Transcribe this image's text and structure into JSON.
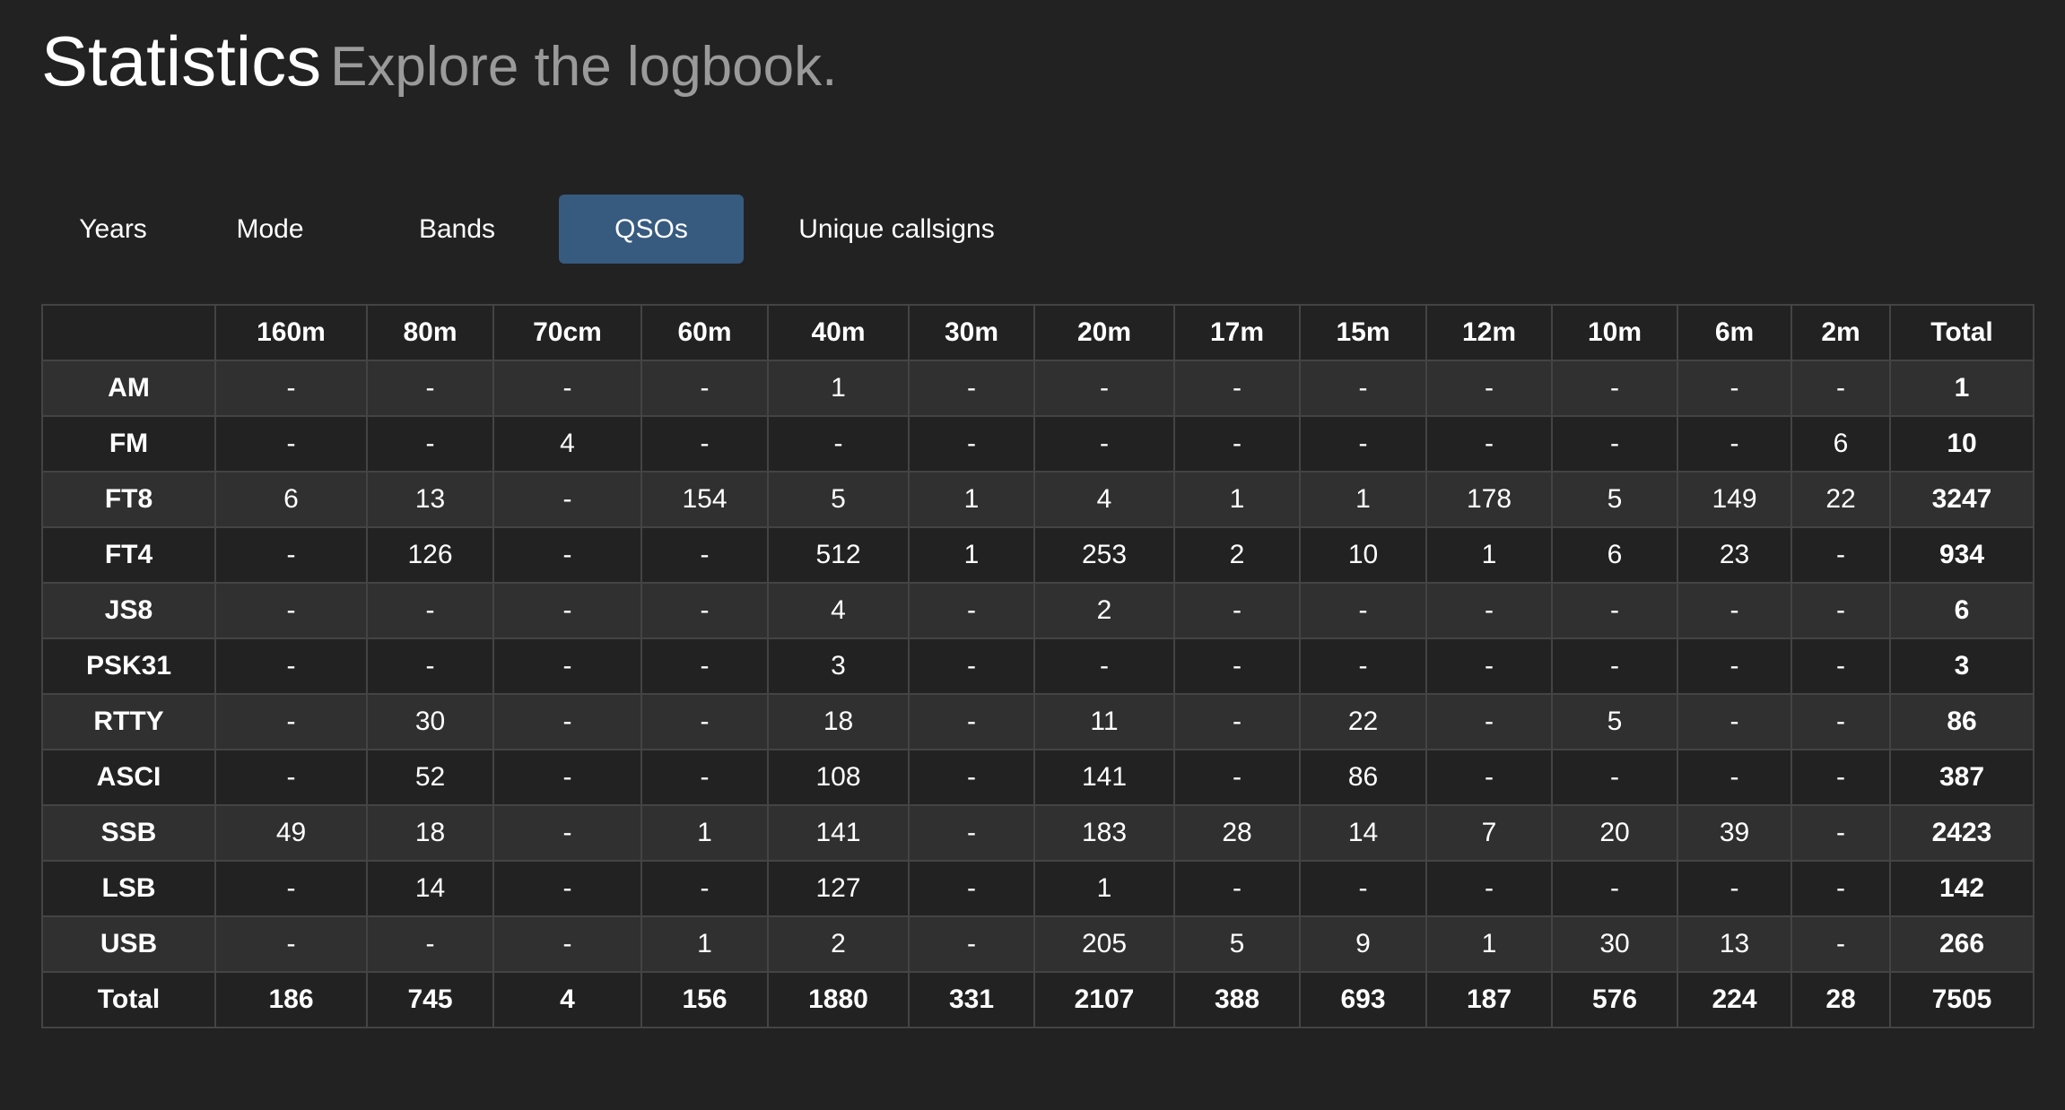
{
  "header": {
    "title": "Statistics",
    "subtitle": "Explore the logbook."
  },
  "tabs": [
    {
      "label": "Years",
      "active": false
    },
    {
      "label": "Mode",
      "active": false
    },
    {
      "label": "Bands",
      "active": false
    },
    {
      "label": "QSOs",
      "active": true
    },
    {
      "label": "Unique callsigns",
      "active": false
    }
  ],
  "colors": {
    "background": "#222222",
    "active_tab": "#375a7f",
    "row_stripe": "#303030",
    "border": "#444444",
    "subtitle": "#9a9a9a"
  },
  "table": {
    "columns": [
      "",
      "160m",
      "80m",
      "70cm",
      "60m",
      "40m",
      "30m",
      "20m",
      "17m",
      "15m",
      "12m",
      "10m",
      "6m",
      "2m",
      "Total"
    ],
    "rows": [
      {
        "mode": "AM",
        "cells": [
          "-",
          "-",
          "-",
          "-",
          "1",
          "-",
          "-",
          "-",
          "-",
          "-",
          "-",
          "-",
          "-",
          "1"
        ]
      },
      {
        "mode": "FM",
        "cells": [
          "-",
          "-",
          "4",
          "-",
          "-",
          "-",
          "-",
          "-",
          "-",
          "-",
          "-",
          "-",
          "6",
          "10"
        ]
      },
      {
        "mode": "FT8",
        "cells": [
          "6",
          "13",
          "-",
          "154",
          "5",
          "1",
          "4",
          "1",
          "1",
          "178",
          "5",
          "149",
          "22",
          "3247"
        ]
      },
      {
        "mode": "FT4",
        "cells": [
          "-",
          "126",
          "-",
          "-",
          "512",
          "1",
          "253",
          "2",
          "10",
          "1",
          "6",
          "23",
          "-",
          "934"
        ]
      },
      {
        "mode": "JS8",
        "cells": [
          "-",
          "-",
          "-",
          "-",
          "4",
          "-",
          "2",
          "-",
          "-",
          "-",
          "-",
          "-",
          "-",
          "6"
        ]
      },
      {
        "mode": "PSK31",
        "cells": [
          "-",
          "-",
          "-",
          "-",
          "3",
          "-",
          "-",
          "-",
          "-",
          "-",
          "-",
          "-",
          "-",
          "3"
        ]
      },
      {
        "mode": "RTTY",
        "cells": [
          "-",
          "30",
          "-",
          "-",
          "18",
          "-",
          "11",
          "-",
          "22",
          "-",
          "5",
          "-",
          "-",
          "86"
        ]
      },
      {
        "mode": "ASCI",
        "cells": [
          "-",
          "52",
          "-",
          "-",
          "108",
          "-",
          "141",
          "-",
          "86",
          "-",
          "-",
          "-",
          "-",
          "387"
        ]
      },
      {
        "mode": "SSB",
        "cells": [
          "49",
          "18",
          "-",
          "1",
          "141",
          "-",
          "183",
          "28",
          "14",
          "7",
          "20",
          "39",
          "-",
          "2423"
        ]
      },
      {
        "mode": "LSB",
        "cells": [
          "-",
          "14",
          "-",
          "-",
          "127",
          "-",
          "1",
          "-",
          "-",
          "-",
          "-",
          "-",
          "-",
          "142"
        ]
      },
      {
        "mode": "USB",
        "cells": [
          "-",
          "-",
          "-",
          "1",
          "2",
          "-",
          "205",
          "5",
          "9",
          "1",
          "30",
          "13",
          "-",
          "266"
        ]
      }
    ],
    "total_row": {
      "label": "Total",
      "cells": [
        "186",
        "745",
        "4",
        "156",
        "1880",
        "331",
        "2107",
        "388",
        "693",
        "187",
        "576",
        "224",
        "28",
        "7505"
      ]
    }
  }
}
